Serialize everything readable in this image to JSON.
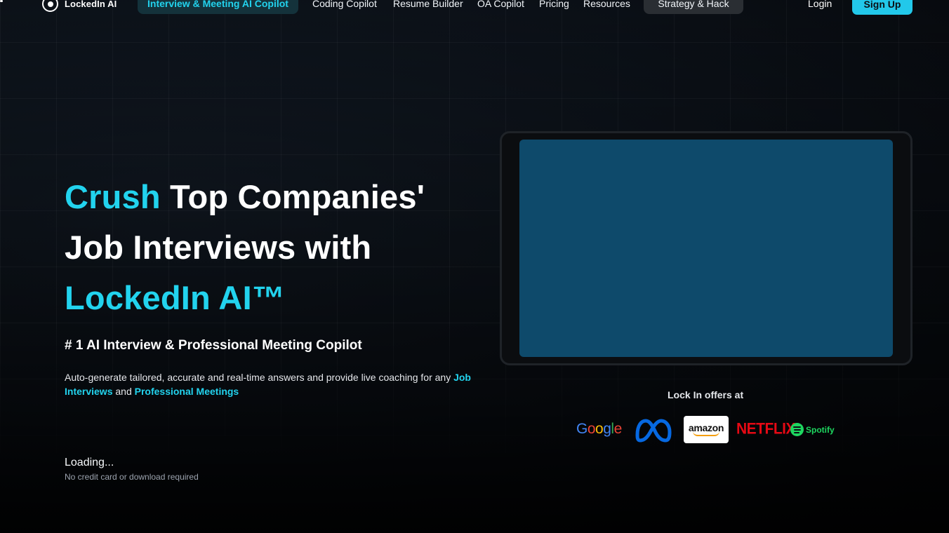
{
  "nav": {
    "brand": "LockedIn AI",
    "active_item": "Interview & Meeting AI Copilot",
    "items": [
      "Coding Copilot",
      "Resume Builder",
      "OA Copilot",
      "Pricing",
      "Resources"
    ],
    "highlight_item": "Strategy & Hack",
    "login": "Login",
    "signup": "Sign Up"
  },
  "hero": {
    "title_highlight_1": "Crush",
    "title_part_2": " Top Companies' Job Interviews with ",
    "title_highlight_2": "LockedIn AI™",
    "subtitle": "# 1 AI Interview & Professional Meeting Copilot",
    "desc_prefix": "Auto-generate tailored, accurate and real-time answers and provide live coaching for any ",
    "desc_link_1": "Job Interviews",
    "desc_mid": " and ",
    "desc_link_2": "Professional Meetings",
    "loading": "Loading...",
    "note": "No credit card or download required"
  },
  "offers": {
    "label": "Lock In offers at",
    "companies": [
      "Google",
      "Meta",
      "amazon",
      "NETFLIX",
      "Spotify"
    ]
  },
  "colors": {
    "accent": "#22d3ee",
    "video_placeholder": "#0e4a6b",
    "signup_bg": "#22c8ea"
  }
}
